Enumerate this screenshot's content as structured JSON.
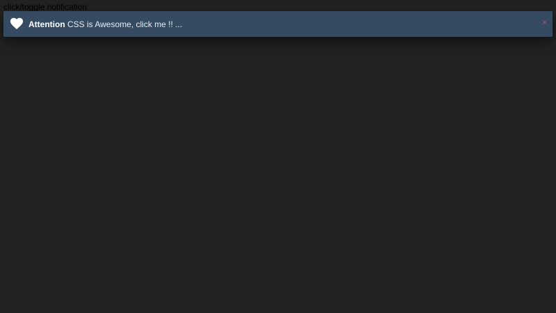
{
  "toggle": {
    "label": "click/toggle notification"
  },
  "notification": {
    "icon": "heart-icon",
    "title": "Attention",
    "message": "CSS is Awesome, click me !! ...",
    "close_label": "×"
  },
  "colors": {
    "page_background": "#222222",
    "notification_background": "#364b61",
    "close_color": "#a85b6f",
    "icon_color": "#ffffff"
  }
}
